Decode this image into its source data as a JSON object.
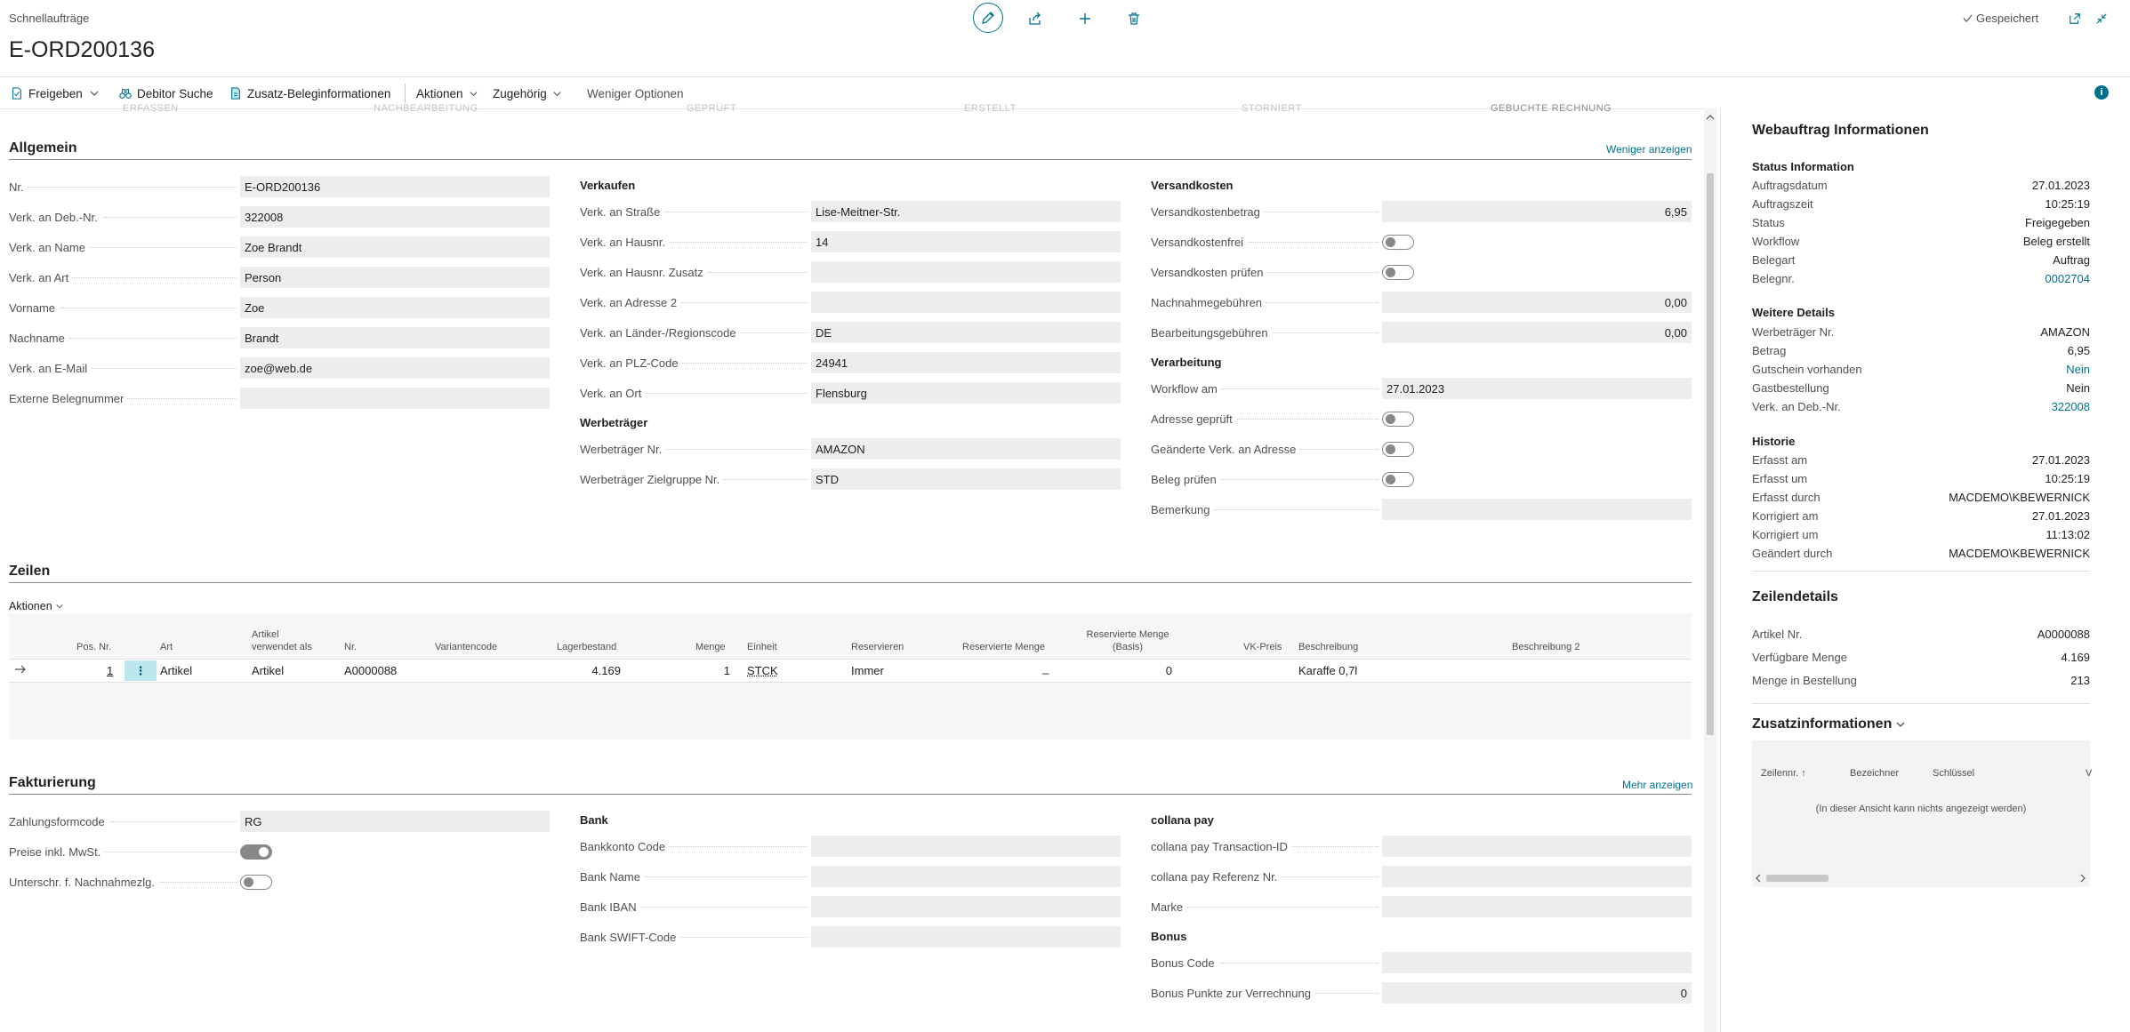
{
  "header": {
    "caption": "Schnellaufträge",
    "title": "E-ORD200136",
    "saved": "Gespeichert"
  },
  "actions": {
    "release": "Freigeben",
    "customer_search": "Debitor Suche",
    "extra_doc_info": "Zusatz-Beleginformationen",
    "actions_menu": "Aktionen",
    "related": "Zugehörig",
    "fewer_options": "Weniger Optionen"
  },
  "general": {
    "title": "Allgemein",
    "toggle_link": "Weniger anzeigen",
    "left": [
      {
        "label": "Nr.",
        "value": "E-ORD200136"
      },
      {
        "label": "Verk. an Deb.-Nr.",
        "value": "322008"
      },
      {
        "label": "Verk. an Name",
        "value": "Zoe Brandt"
      },
      {
        "label": "Verk. an Art",
        "value": "Person"
      },
      {
        "label": "Vorname",
        "value": "Zoe"
      },
      {
        "label": "Nachname",
        "value": "Brandt"
      },
      {
        "label": "Verk. an E-Mail",
        "value": "zoe@web.de"
      },
      {
        "label": "Externe Belegnummer",
        "value": ""
      }
    ],
    "sales_title": "Verkaufen",
    "sales": [
      {
        "label": "Verk. an Straße",
        "value": "Lise-Meitner-Str."
      },
      {
        "label": "Verk. an Hausnr.",
        "value": "14"
      },
      {
        "label": "Verk. an Hausnr. Zusatz",
        "value": ""
      },
      {
        "label": "Verk. an Adresse 2",
        "value": ""
      },
      {
        "label": "Verk. an Länder-/Regionscode",
        "value": "DE"
      },
      {
        "label": "Verk. an PLZ-Code",
        "value": "24941"
      },
      {
        "label": "Verk. an Ort",
        "value": "Flensburg"
      }
    ],
    "promoter_title": "Werbeträger",
    "promoter": [
      {
        "label": "Werbeträger Nr.",
        "value": "AMAZON"
      },
      {
        "label": "Werbeträger Zielgruppe Nr.",
        "value": "STD"
      }
    ],
    "shipping_title": "Versandkosten",
    "shipping_cost_label": "Versandkostenbetrag",
    "shipping_cost_value": "6,95",
    "shipping_free_label": "Versandkostenfrei",
    "shipping_check_label": "Versandkosten prüfen",
    "cod_fee_label": "Nachnahmegebühren",
    "cod_fee_value": "0,00",
    "handling_fee_label": "Bearbeitungsgebühren",
    "handling_fee_value": "0,00",
    "processing_title": "Verarbeitung",
    "workflow_at_label": "Workflow am",
    "workflow_at_value": "27.01.2023",
    "address_checked_label": "Adresse geprüft",
    "changed_address_label": "Geänderte Verk. an Adresse",
    "check_doc_label": "Beleg prüfen",
    "remark_label": "Bemerkung"
  },
  "lines": {
    "title": "Zeilen",
    "actions": "Aktionen",
    "columns": {
      "pos": "Pos. Nr.",
      "type": "Art",
      "item_used_as": "Artikel verwendet als",
      "no": "Nr.",
      "variant": "Variantencode",
      "stock": "Lagerbestand",
      "qty": "Menge",
      "unit": "Einheit",
      "reserve": "Reservieren",
      "reserved_qty": "Reservierte Menge",
      "reserved_qty_base": "Reservierte Menge (Basis)",
      "price": "VK-Preis",
      "desc": "Beschreibung",
      "desc2": "Beschreibung 2"
    },
    "row": {
      "pos": "1",
      "type": "Artikel",
      "item_used_as": "Artikel",
      "no": "A0000088",
      "stock": "4.169",
      "qty": "1",
      "unit": "STCK",
      "reserve": "Immer",
      "reserved_qty": "_",
      "reserved_qty_base": "0",
      "desc": "Karaffe 0,7l"
    }
  },
  "billing": {
    "title": "Fakturierung",
    "toggle_link": "Mehr anzeigen",
    "payment_method_label": "Zahlungsformcode",
    "payment_method_value": "RG",
    "prices_incl_vat_label": "Preise inkl. MwSt.",
    "cod_signature_label": "Unterschr. f. Nachnahmezlg.",
    "bank_title": "Bank",
    "bank": [
      {
        "label": "Bankkonto Code",
        "value": ""
      },
      {
        "label": "Bank Name",
        "value": ""
      },
      {
        "label": "Bank IBAN",
        "value": ""
      },
      {
        "label": "Bank SWIFT-Code",
        "value": ""
      }
    ],
    "collana_title": "collana pay",
    "collana": [
      {
        "label": "collana pay Transaction-ID",
        "value": ""
      },
      {
        "label": "collana pay Referenz Nr.",
        "value": ""
      },
      {
        "label": "Marke",
        "value": ""
      }
    ],
    "bonus_title": "Bonus",
    "bonus_code_label": "Bonus Code",
    "bonus_points_label": "Bonus Punkte zur Verrechnung",
    "bonus_points_value": "0"
  },
  "factbox": {
    "title": "Webauftrag Informationen",
    "status_title": "Status Information",
    "status": [
      {
        "label": "Auftragsdatum",
        "value": "27.01.2023"
      },
      {
        "label": "Auftragszeit",
        "value": "10:25:19"
      },
      {
        "label": "Status",
        "value": "Freigegeben"
      },
      {
        "label": "Workflow",
        "value": "Beleg erstellt"
      },
      {
        "label": "Belegart",
        "value": "Auftrag"
      },
      {
        "label": "Belegnr.",
        "value": "0002704"
      }
    ],
    "details_title": "Weitere Details",
    "details": [
      {
        "label": "Werbeträger Nr.",
        "value": "AMAZON"
      },
      {
        "label": "Betrag",
        "value": "6,95"
      },
      {
        "label": "Gutschein vorhanden",
        "value": "Nein"
      },
      {
        "label": "Gastbestellung",
        "value": "Nein"
      },
      {
        "label": "Verk. an Deb.-Nr.",
        "value": "322008"
      }
    ],
    "history_title": "Historie",
    "history": [
      {
        "label": "Erfasst am",
        "value": "27.01.2023"
      },
      {
        "label": "Erfasst um",
        "value": "10:25:19"
      },
      {
        "label": "Erfasst durch",
        "value": "MACDEMO\\KBEWERNICK"
      },
      {
        "label": "Korrigiert am",
        "value": "27.01.2023"
      },
      {
        "label": "Korrigiert um",
        "value": "11:13:02"
      },
      {
        "label": "Geändert durch",
        "value": "MACDEMO\\KBEWERNICK"
      }
    ],
    "line_details_title": "Zeilendetails",
    "line_details": [
      {
        "label": "Artikel Nr.",
        "value": "A0000088"
      },
      {
        "label": "Verfügbare Menge",
        "value": "4.169"
      },
      {
        "label": "Menge in Bestellung",
        "value": "213"
      }
    ],
    "extra_title": "Zusatzinformationen",
    "extra_col1": "Zeilennr.",
    "extra_col2": "Bezeichner",
    "extra_col3": "Schlüssel",
    "extra_empty": "(In dieser Ansicht kann nichts angezeigt werden)"
  },
  "ghost_steps": [
    "ERFASSEN",
    "NACHBEARBEITUNG",
    "GEPRÜFT",
    "ERSTELLT",
    "STORNIERT",
    "GEBUCHTE RECHNUNG"
  ]
}
